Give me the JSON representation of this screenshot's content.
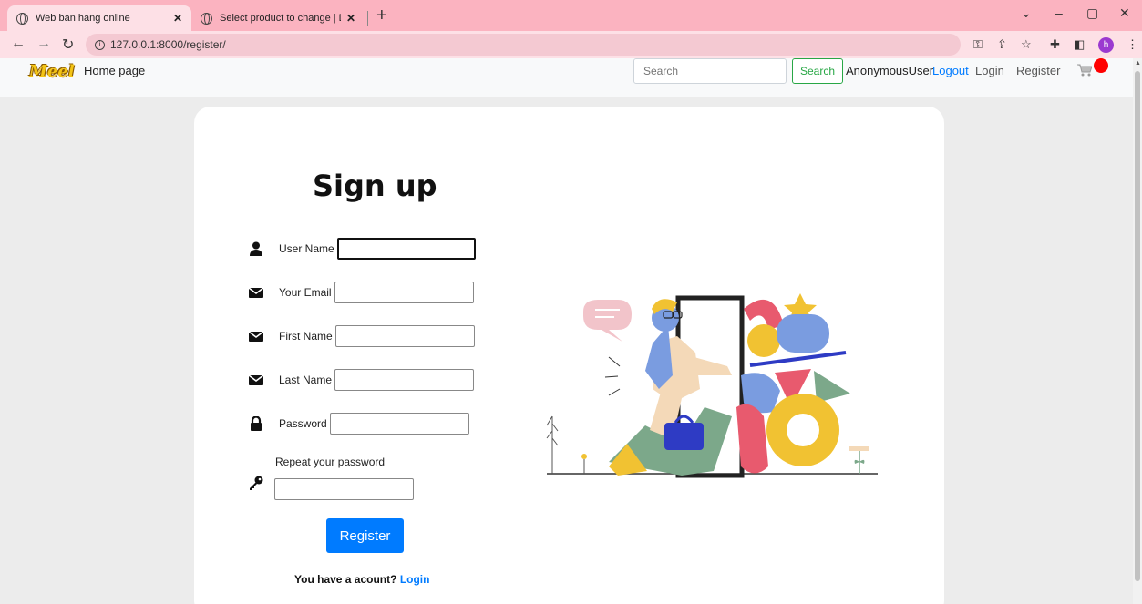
{
  "browser": {
    "tabs": [
      {
        "title": "Web ban hang online",
        "active": true
      },
      {
        "title": "Select product to change | Djang",
        "active": false
      }
    ],
    "url": "127.0.0.1:8000/register/"
  },
  "navbar": {
    "logo_text": "Meel",
    "home_label": "Home page",
    "search_placeholder": "Search",
    "search_button": "Search",
    "username": "AnonymousUser",
    "logout_label": "Logout",
    "login_label": "Login",
    "register_label": "Register"
  },
  "form": {
    "title": "Sign up",
    "fields": {
      "username": {
        "label": "User Name",
        "value": ""
      },
      "email": {
        "label": "Your Email",
        "value": ""
      },
      "first_name": {
        "label": "First Name",
        "value": ""
      },
      "last_name": {
        "label": "Last Name",
        "value": ""
      },
      "password": {
        "label": "Password",
        "value": ""
      },
      "repeat_password": {
        "label": "Repeat your password",
        "value": ""
      }
    },
    "submit_label": "Register",
    "have_account_text": "You have a acount?",
    "login_link": "Login"
  },
  "colors": {
    "primary": "#007bff",
    "success": "#28a745",
    "chrome_tab": "#fbb3c0",
    "cart_badge": "#ff0000"
  }
}
